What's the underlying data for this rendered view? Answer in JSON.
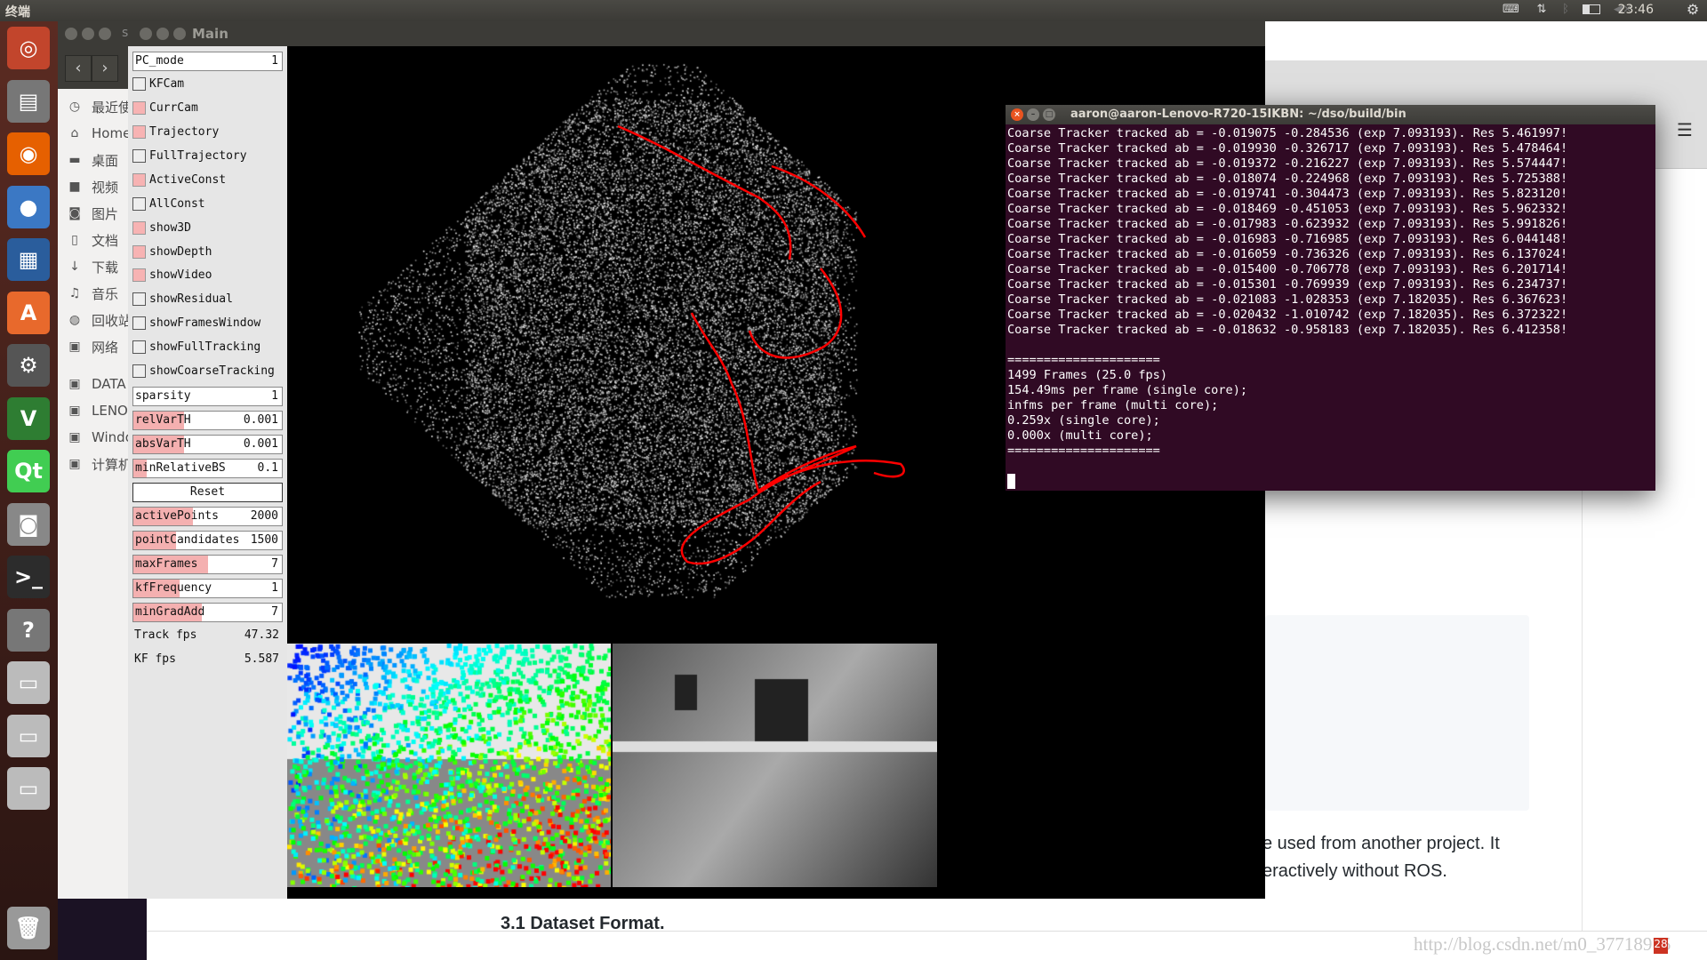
{
  "topbar": {
    "title": "终端",
    "clock": "23:46",
    "tray_icons": [
      "keyboard-icon",
      "network-arrows-icon",
      "bluetooth-icon",
      "battery-icon",
      "volume-muted-icon",
      "power-gear-icon"
    ]
  },
  "launcher": {
    "icons": [
      "ubuntu-dash-icon",
      "files-icon",
      "firefox-icon",
      "chromium-icon",
      "writer-icon",
      "software-center-icon",
      "system-settings-icon",
      "vim-icon",
      "qt-creator-icon",
      "camera-icon",
      "terminal-icon",
      "help-icon",
      "drive-icon",
      "drive-icon",
      "drive-icon",
      "trash-icon"
    ]
  },
  "nautilus": {
    "title_partial": "s",
    "items": [
      {
        "icon": "clock-icon",
        "label": "最近使"
      },
      {
        "icon": "home-icon",
        "label": "Home"
      },
      {
        "icon": "folder-icon",
        "label": "桌面"
      },
      {
        "icon": "video-icon",
        "label": "视频"
      },
      {
        "icon": "camera-icon",
        "label": "图片"
      },
      {
        "icon": "document-icon",
        "label": "文档"
      },
      {
        "icon": "download-icon",
        "label": "下载"
      },
      {
        "icon": "music-icon",
        "label": "音乐"
      },
      {
        "icon": "trash-icon",
        "label": "回收站"
      },
      {
        "icon": "network-icon",
        "label": "网络"
      },
      {
        "icon": "drive-icon",
        "label": "DATA"
      },
      {
        "icon": "drive-icon",
        "label": "LENO"
      },
      {
        "icon": "drive-icon",
        "label": "Windo"
      },
      {
        "icon": "drive-icon",
        "label": "计算机"
      }
    ]
  },
  "main": {
    "title": "Main",
    "panel": [
      {
        "type": "field",
        "label": "PC_mode",
        "value": "1",
        "fill": 0
      },
      {
        "type": "check",
        "label": "KFCam",
        "checked": false
      },
      {
        "type": "check",
        "label": "CurrCam",
        "checked": true
      },
      {
        "type": "check",
        "label": "Trajectory",
        "checked": true
      },
      {
        "type": "check",
        "label": "FullTrajectory",
        "checked": false
      },
      {
        "type": "check",
        "label": "ActiveConst",
        "checked": true
      },
      {
        "type": "check",
        "label": "AllConst",
        "checked": false
      },
      {
        "type": "check",
        "label": "show3D",
        "checked": true
      },
      {
        "type": "check",
        "label": "showDepth",
        "checked": true
      },
      {
        "type": "check",
        "label": "showVideo",
        "checked": true
      },
      {
        "type": "check",
        "label": "showResidual",
        "checked": false
      },
      {
        "type": "check",
        "label": "showFramesWindow",
        "checked": false
      },
      {
        "type": "check",
        "label": "showFullTracking",
        "checked": false
      },
      {
        "type": "check",
        "label": "showCoarseTracking",
        "checked": false
      },
      {
        "type": "field",
        "label": "sparsity",
        "value": "1",
        "fill": 0
      },
      {
        "type": "field",
        "label": "relVarTH",
        "value": "0.001",
        "fill": 0.34
      },
      {
        "type": "field",
        "label": "absVarTH",
        "value": "0.001",
        "fill": 0.34
      },
      {
        "type": "field",
        "label": "minRelativeBS",
        "value": "0.1",
        "fill": 0.09
      },
      {
        "type": "button",
        "label": "Reset"
      },
      {
        "type": "field",
        "label": "activePoints",
        "value": "2000",
        "fill": 0.4
      },
      {
        "type": "field",
        "label": "pointCandidates",
        "value": "1500",
        "fill": 0.29
      },
      {
        "type": "field",
        "label": "maxFrames",
        "value": "7",
        "fill": 0.5
      },
      {
        "type": "field",
        "label": "kfFrequency",
        "value": "1",
        "fill": 0.31
      },
      {
        "type": "field",
        "label": "minGradAdd",
        "value": "7",
        "fill": 0.46
      },
      {
        "type": "readout",
        "label": "Track fps",
        "value": "47.32"
      },
      {
        "type": "readout",
        "label": "KF fps",
        "value": "5.587"
      }
    ],
    "colors": {
      "checked": "#f7b3b3",
      "trajectory": "#ff0000"
    }
  },
  "terminal": {
    "title": "aaron@aaron-Lenovo-R720-15IKBN: ~/dso/build/bin",
    "lines": [
      "Coarse Tracker tracked ab = -0.019075 -0.284536 (exp 7.093193). Res 5.461997!",
      "Coarse Tracker tracked ab = -0.019930 -0.326717 (exp 7.093193). Res 5.478464!",
      "Coarse Tracker tracked ab = -0.019372 -0.216227 (exp 7.093193). Res 5.574447!",
      "Coarse Tracker tracked ab = -0.018074 -0.224968 (exp 7.093193). Res 5.725388!",
      "Coarse Tracker tracked ab = -0.019741 -0.304473 (exp 7.093193). Res 5.823120!",
      "Coarse Tracker tracked ab = -0.018469 -0.451053 (exp 7.093193). Res 5.962332!",
      "Coarse Tracker tracked ab = -0.017983 -0.623932 (exp 7.093193). Res 5.991826!",
      "Coarse Tracker tracked ab = -0.016983 -0.716985 (exp 7.093193). Res 6.044148!",
      "Coarse Tracker tracked ab = -0.016059 -0.736326 (exp 7.093193). Res 6.137024!",
      "Coarse Tracker tracked ab = -0.015400 -0.706778 (exp 7.093193). Res 6.201714!",
      "Coarse Tracker tracked ab = -0.015301 -0.769939 (exp 7.093193). Res 6.234737!",
      "Coarse Tracker tracked ab = -0.021083 -1.028353 (exp 7.182035). Res 6.367623!",
      "Coarse Tracker tracked ab = -0.020432 -1.010742 (exp 7.182035). Res 6.372322!",
      "Coarse Tracker tracked ab = -0.018632 -0.958183 (exp 7.182035). Res 6.412358!",
      "",
      "=====================",
      "1499 Frames (25.0 fps)",
      "154.49ms per frame (single core);",
      "infms per frame (multi core);",
      "0.259x (single core);",
      "0.000x (multi core);",
      "====================="
    ],
    "bg_color": "#300a24"
  },
  "browser": {
    "line1": "e used from another project. It",
    "line2": "eractively without ROS.",
    "heading": "3.1 Dataset Format.",
    "watermark": "http://blog.csdn.net/m0_37718975",
    "badge": "28"
  }
}
